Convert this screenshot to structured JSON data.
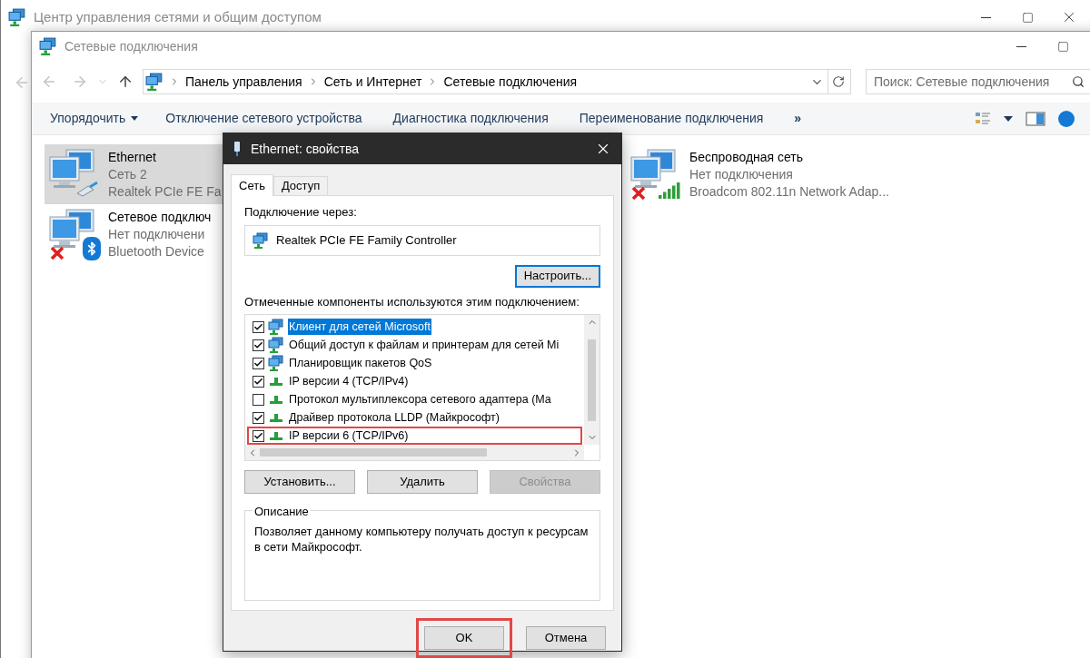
{
  "background_window": {
    "title": "Центр управления сетями и общим доступом"
  },
  "explorer": {
    "title": "Сетевые подключения",
    "breadcrumbs": [
      "Панель управления",
      "Сеть и Интернет",
      "Сетевые подключения"
    ],
    "search": {
      "placeholder": "Поиск: Сетевые подключения"
    },
    "toolbar": [
      {
        "kind": "menu",
        "label": "Упорядочить"
      },
      {
        "kind": "command",
        "label": "Отключение сетевого устройства"
      },
      {
        "kind": "command",
        "label": "Диагностика подключения"
      },
      {
        "kind": "command",
        "label": "Переименование подключения"
      },
      {
        "kind": "overflow",
        "label": "»"
      }
    ],
    "connections": [
      {
        "name": "Ethernet",
        "status": "Сеть 2",
        "adapter": "Realtek PCIe FE Fa",
        "selected": true,
        "kind": "cable",
        "disconnected": false
      },
      {
        "name": "Сетевое подключ",
        "status": "Нет подключени",
        "adapter": "Bluetooth Device",
        "selected": false,
        "kind": "bluetooth",
        "disconnected": true
      },
      {
        "name": "Беспроводная сеть",
        "status": "Нет подключения",
        "adapter": "Broadcom 802.11n Network Adap...",
        "selected": false,
        "kind": "wifi",
        "disconnected": true
      }
    ]
  },
  "dialog": {
    "title": "Ethernet: свойства",
    "tabs": [
      {
        "label": "Сеть",
        "selected": true
      },
      {
        "label": "Доступ",
        "selected": false
      }
    ],
    "connect_using_label": "Подключение через:",
    "adapter": "Realtek PCIe FE Family Controller",
    "configure_button": "Настроить...",
    "components_label": "Отмеченные компоненты используются этим подключением:",
    "components": [
      {
        "kind": "service",
        "label": "Клиент для сетей Microsoft",
        "checked": true,
        "selected": true,
        "highlighted": false
      },
      {
        "kind": "service",
        "label": "Общий доступ к файлам и принтерам для сетей Mi",
        "checked": true,
        "selected": false,
        "highlighted": false
      },
      {
        "kind": "service",
        "label": "Планировщик пакетов QoS",
        "checked": true,
        "selected": false,
        "highlighted": false
      },
      {
        "kind": "protocol",
        "label": "IP версии 4 (TCP/IPv4)",
        "checked": true,
        "selected": false,
        "highlighted": false
      },
      {
        "kind": "protocol",
        "label": "Протокол мультиплексора сетевого адаптера (Ма",
        "checked": false,
        "selected": false,
        "highlighted": false
      },
      {
        "kind": "protocol",
        "label": "Драйвер протокола LLDP (Майкрософт)",
        "checked": true,
        "selected": false,
        "highlighted": false
      },
      {
        "kind": "protocol",
        "label": "IP версии 6 (TCP/IPv6)",
        "checked": true,
        "selected": false,
        "highlighted": true
      }
    ],
    "component_buttons": [
      {
        "label": "Установить...",
        "disabled": false
      },
      {
        "label": "Удалить",
        "disabled": false
      },
      {
        "label": "Свойства",
        "disabled": true
      }
    ],
    "description": {
      "title": "Описание",
      "text": "Позволяет данному компьютеру получать доступ к ресурсам в сети Майкрософт."
    },
    "footer_buttons": [
      {
        "label": "OK",
        "highlighted": true
      },
      {
        "label": "Отмена",
        "highlighted": false
      }
    ]
  }
}
